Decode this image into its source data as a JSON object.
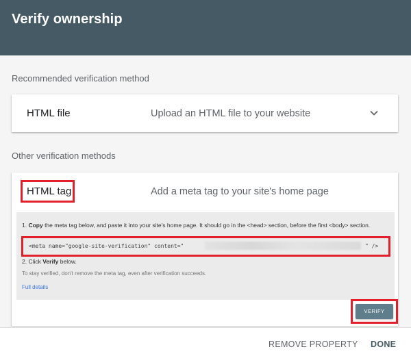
{
  "dialog": {
    "title": "Verify ownership"
  },
  "recommended": {
    "section_label": "Recommended verification method",
    "method_name": "HTML file",
    "method_desc": "Upload an HTML file to your website",
    "expand_icon": "chevron-down-icon"
  },
  "other": {
    "section_label": "Other verification methods",
    "method_name": "HTML tag",
    "method_desc": "Add a meta tag to your site's home page",
    "step1_copy": "Copy",
    "step1_text": " the meta tag below, and paste it into your site's home page. It should go in the <head> section, before the first <body> section.",
    "step1_num": "1. ",
    "meta_tag_prefix": "<meta name=\"google-site-verification\" content=\"",
    "meta_tag_suffix": "\" />",
    "step2_num": "2. Click ",
    "step2_bold": "Verify",
    "step2_text": " below.",
    "note": "To stay verified, don't remove the meta tag, even after verification succeeds.",
    "full_details_link": "Full details",
    "verify_button": "VERIFY"
  },
  "footer": {
    "remove_property": "REMOVE PROPERTY",
    "done": "DONE"
  },
  "colors": {
    "header_bg": "#455a64",
    "highlight": "#e0202a",
    "verify_bg": "#607d8b",
    "link": "#3b78e7"
  }
}
